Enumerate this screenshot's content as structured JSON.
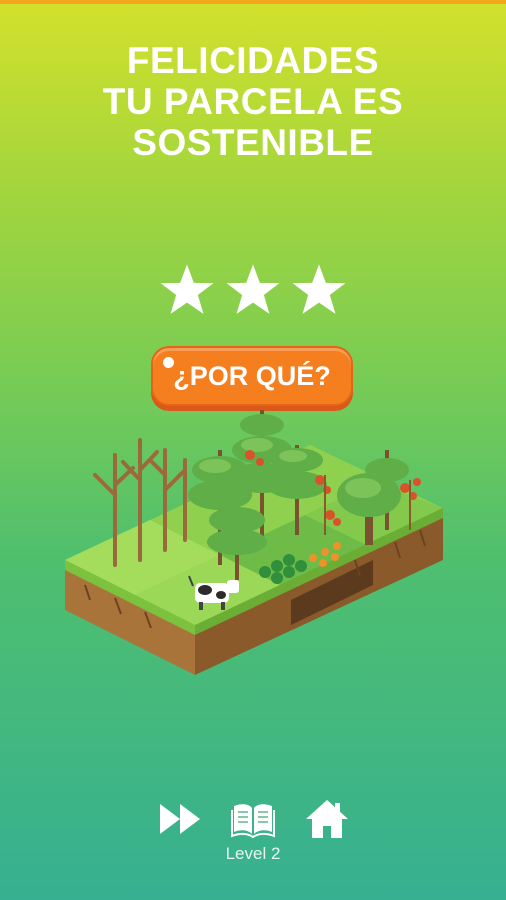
{
  "title": {
    "line1": "FELICIDADES",
    "line2": "TU PARCELA ES",
    "line3": "SOSTENIBLE"
  },
  "stars": {
    "earned": 3,
    "total": 3
  },
  "why_button": {
    "label": "¿POR QUÉ?"
  },
  "controls": {
    "skip_icon": "fast-forward-icon",
    "book_icon": "open-book-icon",
    "home_icon": "home-icon"
  },
  "level_label": "Level 2",
  "colors": {
    "gradient_top": "#d3e12c",
    "gradient_bottom": "#36b091",
    "button_orange": "#f57e1f",
    "top_bar": "#f5a51c"
  }
}
